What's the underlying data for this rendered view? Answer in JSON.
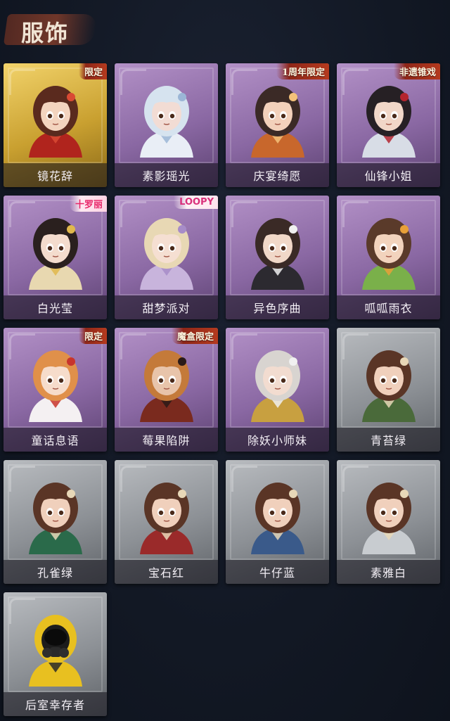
{
  "header": {
    "title": "服饰"
  },
  "costumes": [
    {
      "name": "镜花辞",
      "rarity": "gold",
      "badge": "限定",
      "badge_style": "red",
      "palette": {
        "skin": "#f3d4bf",
        "hair": "#5a2a1e",
        "outfit": "#b0241d",
        "accent": "#d94a34"
      }
    },
    {
      "name": "素影瑶光",
      "rarity": "purple",
      "badge": "",
      "badge_style": "",
      "palette": {
        "skin": "#f2dcd4",
        "hair": "#d6e3ef",
        "outfit": "#e9eef6",
        "accent": "#9bb6d6"
      }
    },
    {
      "name": "庆宴绮愿",
      "rarity": "purple",
      "badge": "1周年限定",
      "badge_style": "red",
      "palette": {
        "skin": "#f3d1bb",
        "hair": "#3b2a26",
        "outfit": "#c8672c",
        "accent": "#f4c27a"
      }
    },
    {
      "name": "仙锋小姐",
      "rarity": "purple",
      "badge": "非遗锥戏",
      "badge_style": "red",
      "palette": {
        "skin": "#f1d7c8",
        "hair": "#262024",
        "outfit": "#d8dde6",
        "accent": "#b4252e"
      }
    },
    {
      "name": "白光莹",
      "rarity": "purple",
      "badge": "十罗丽",
      "badge_style": "pink",
      "palette": {
        "skin": "#f4dccd",
        "hair": "#2a201e",
        "outfit": "#e8d8b0",
        "accent": "#e0b84c"
      }
    },
    {
      "name": "甜梦派对",
      "rarity": "purple",
      "badge": "LOOPY",
      "badge_style": "loopy",
      "palette": {
        "skin": "#f5dfd2",
        "hair": "#e8d8b4",
        "outfit": "#c8b4dc",
        "accent": "#a78cc8"
      }
    },
    {
      "name": "异色序曲",
      "rarity": "purple",
      "badge": "",
      "badge_style": "",
      "palette": {
        "skin": "#f1d8c8",
        "hair": "#3a2a26",
        "outfit": "#2c2a30",
        "accent": "#f0f0f0"
      }
    },
    {
      "name": "呱呱雨衣",
      "rarity": "purple",
      "badge": "",
      "badge_style": "",
      "palette": {
        "skin": "#f2d3bd",
        "hair": "#5a3a2a",
        "outfit": "#7ab04a",
        "accent": "#e8a038"
      }
    },
    {
      "name": "童话息语",
      "rarity": "purple",
      "badge": "限定",
      "badge_style": "red",
      "palette": {
        "skin": "#f6dccb",
        "hair": "#e0904a",
        "outfit": "#f4f0f2",
        "accent": "#c8342c"
      }
    },
    {
      "name": "莓果陷阱",
      "rarity": "purple",
      "badge": "魔盒限定",
      "badge_style": "red",
      "palette": {
        "skin": "#e8c4aa",
        "hair": "#c47a3a",
        "outfit": "#7a2a1e",
        "accent": "#2a1a18"
      }
    },
    {
      "name": "除妖小师妹",
      "rarity": "purple",
      "badge": "",
      "badge_style": "",
      "palette": {
        "skin": "#f2dcd0",
        "hair": "#d8d4d0",
        "outfit": "#c8a040",
        "accent": "#f0f0f0"
      }
    },
    {
      "name": "青苔绿",
      "rarity": "gray",
      "badge": "",
      "badge_style": "",
      "palette": {
        "skin": "#f0d0bc",
        "hair": "#5a3526",
        "outfit": "#4a6a3a",
        "accent": "#e8d8b8"
      }
    },
    {
      "name": "孔雀绿",
      "rarity": "gray",
      "badge": "",
      "badge_style": "",
      "palette": {
        "skin": "#f0d0bc",
        "hair": "#5a3526",
        "outfit": "#2a6a4a",
        "accent": "#e8d8b8"
      }
    },
    {
      "name": "宝石红",
      "rarity": "gray",
      "badge": "",
      "badge_style": "",
      "palette": {
        "skin": "#f0d0bc",
        "hair": "#5a3526",
        "outfit": "#9a2a2a",
        "accent": "#e8d8b8"
      }
    },
    {
      "name": "牛仔蓝",
      "rarity": "gray",
      "badge": "",
      "badge_style": "",
      "palette": {
        "skin": "#f0d0bc",
        "hair": "#5a3526",
        "outfit": "#3a5a8a",
        "accent": "#e8d8b8"
      }
    },
    {
      "name": "素雅白",
      "rarity": "gray",
      "badge": "",
      "badge_style": "",
      "palette": {
        "skin": "#f0d0bc",
        "hair": "#5a3526",
        "outfit": "#c8ccd0",
        "accent": "#e8d8b8"
      }
    },
    {
      "name": "后室幸存者",
      "rarity": "gray",
      "badge": "",
      "badge_style": "",
      "palette": {
        "skin": "#1c1c1c",
        "hair": "#e8c020",
        "outfit": "#e8c020",
        "accent": "#2a2a2a"
      }
    }
  ]
}
